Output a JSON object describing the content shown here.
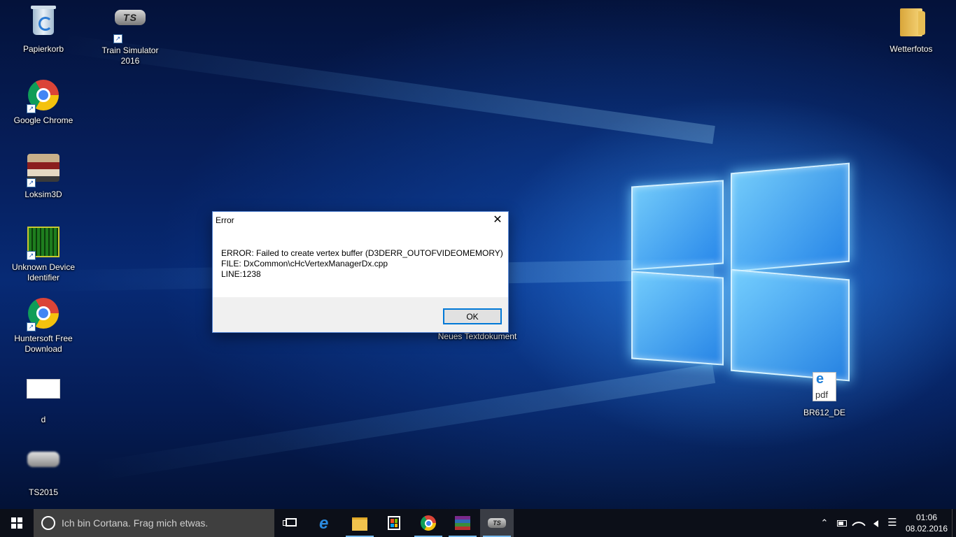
{
  "desktop": {
    "icons": [
      {
        "label": "Papierkorb",
        "icon": "recycle-bin-icon"
      },
      {
        "label": "Train Simulator 2016",
        "icon": "train-simulator-icon"
      },
      {
        "label": "Google Chrome",
        "icon": "chrome-icon"
      },
      {
        "label": "Loksim3D",
        "icon": "loksim-icon"
      },
      {
        "label": "Unknown Device Identifier",
        "icon": "device-identifier-icon"
      },
      {
        "label": "Huntersoft Free Download",
        "icon": "chrome-icon"
      },
      {
        "label": "d",
        "icon": "document-icon"
      },
      {
        "label": "TS2015",
        "icon": "ts2015-icon"
      },
      {
        "label": "Wetterfotos",
        "icon": "folder-icon"
      },
      {
        "label": "BR612_DE",
        "icon": "pdf-icon"
      },
      {
        "label": "Neues Textdokument",
        "icon": "text-document-icon"
      }
    ]
  },
  "dialog": {
    "title": "Error",
    "message": "ERROR: Failed to create vertex buffer (D3DERR_OUTOFVIDEOMEMORY)\nFILE: DxCommon\\cHcVertexManagerDx.cpp\nLINE:1238",
    "ok_label": "OK",
    "close_glyph": "✕"
  },
  "taskbar": {
    "search_placeholder": "Ich bin Cortana. Frag mich etwas.",
    "ts_label": "TS",
    "apps": [
      "task-view",
      "edge",
      "file-explorer",
      "store",
      "chrome",
      "winrar",
      "train-simulator"
    ],
    "tray": {
      "chevron": "⌃",
      "action_center": "☰"
    },
    "clock": {
      "time": "01:06",
      "date": "08.02.2016"
    }
  },
  "colors": {
    "accent": "#0078d7",
    "taskbar": "#0c0f18",
    "search_box": "#3f3f3f"
  }
}
